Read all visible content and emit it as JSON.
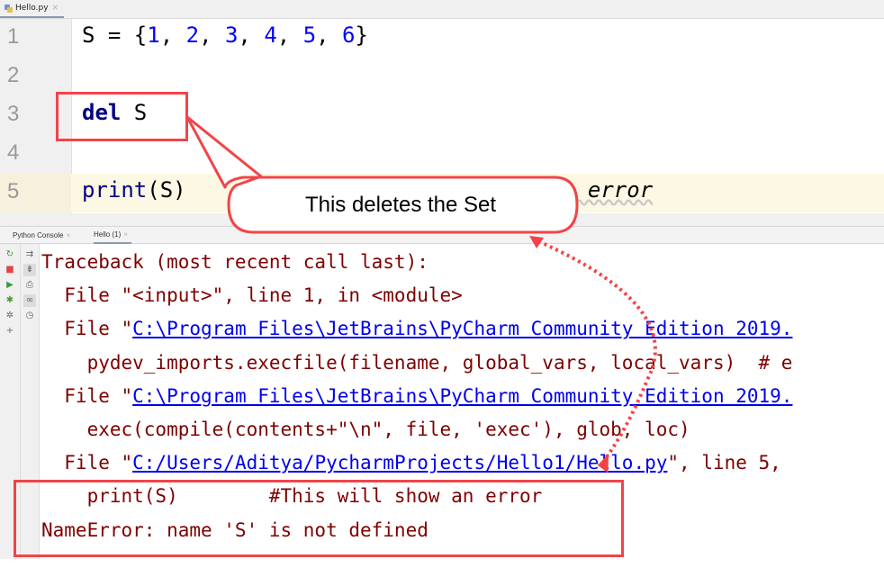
{
  "editor": {
    "tab": {
      "label": "Hello.py",
      "icon": "python-file-icon",
      "close": "×"
    },
    "lines": [
      {
        "num": "1",
        "tokens": [
          {
            "t": "S = {",
            "c": "plain"
          },
          {
            "t": "1",
            "c": "num"
          },
          {
            "t": ", ",
            "c": "plain"
          },
          {
            "t": "2",
            "c": "num"
          },
          {
            "t": ", ",
            "c": "plain"
          },
          {
            "t": "3",
            "c": "num"
          },
          {
            "t": ", ",
            "c": "plain"
          },
          {
            "t": "4",
            "c": "num"
          },
          {
            "t": ", ",
            "c": "plain"
          },
          {
            "t": "5",
            "c": "num"
          },
          {
            "t": ", ",
            "c": "plain"
          },
          {
            "t": "6",
            "c": "num"
          },
          {
            "t": "}",
            "c": "plain"
          }
        ]
      },
      {
        "num": "2",
        "tokens": []
      },
      {
        "num": "3",
        "tokens": [
          {
            "t": "del",
            "c": "kw"
          },
          {
            "t": " S",
            "c": "plain"
          }
        ]
      },
      {
        "num": "4",
        "tokens": []
      },
      {
        "num": "5",
        "tokens": [
          {
            "t": "print",
            "c": "builtin"
          },
          {
            "t": "(S)",
            "c": "plain"
          }
        ],
        "trailing_comment_visible": "n error"
      }
    ]
  },
  "run_window": {
    "tabs": [
      {
        "label": "Python Console",
        "close": "×",
        "active": false
      },
      {
        "label": "Hello (1)",
        "close": "×",
        "active": true
      }
    ],
    "toolbar_left": [
      {
        "icon": "rerun-icon",
        "glyph": "↻",
        "color": "#3c9a3c"
      },
      {
        "icon": "stop-icon",
        "glyph": "■",
        "color": "#e04545"
      },
      {
        "icon": "run-icon",
        "glyph": "▶",
        "color": "#3c9a3c"
      },
      {
        "icon": "debug-icon",
        "glyph": "✱",
        "color": "#4a9a3a"
      },
      {
        "icon": "settings-icon",
        "glyph": "✲",
        "color": "#666666"
      },
      {
        "icon": "add-icon",
        "glyph": "+",
        "color": "#666666"
      }
    ],
    "toolbar_right": [
      {
        "icon": "soft-wrap-icon",
        "glyph": "⇉",
        "color": "#666666",
        "pressed": false
      },
      {
        "icon": "scroll-to-end-icon",
        "glyph": "⇟",
        "color": "#666666",
        "pressed": true
      },
      {
        "icon": "print-icon",
        "glyph": "⎙",
        "color": "#666666",
        "pressed": false
      },
      {
        "icon": "show-variables-icon",
        "glyph": "∞",
        "color": "#666666",
        "pressed": true
      },
      {
        "icon": "history-icon",
        "glyph": "◷",
        "color": "#666666",
        "pressed": false
      }
    ],
    "console_lines": [
      {
        "parts": [
          {
            "t": "Traceback (most recent call last):"
          }
        ]
      },
      {
        "parts": [
          {
            "t": "  File \"<input>\", line 1, in <module>"
          }
        ]
      },
      {
        "parts": [
          {
            "t": "  File \""
          },
          {
            "t": "C:\\Program Files\\JetBrains\\PyCharm Community Edition 2019.",
            "link": true
          }
        ]
      },
      {
        "parts": [
          {
            "t": "    pydev_imports.execfile(filename, global_vars, local_vars)  # e"
          }
        ]
      },
      {
        "parts": [
          {
            "t": "  File \""
          },
          {
            "t": "C:\\Program Files\\JetBrains\\PyCharm Community Edition 2019.",
            "link": true
          }
        ]
      },
      {
        "parts": [
          {
            "t": "    exec(compile(contents+\"\\n\", file, 'exec'), glob, loc)"
          }
        ]
      },
      {
        "parts": [
          {
            "t": "  File \""
          },
          {
            "t": "C:/Users/Aditya/PycharmProjects/Hello1/Hello.py",
            "link": true
          },
          {
            "t": "\", line 5,"
          }
        ]
      },
      {
        "parts": [
          {
            "t": "    print(S)        #This will show an error"
          }
        ]
      },
      {
        "parts": [
          {
            "t": "NameError: name 'S' is not defined"
          }
        ]
      }
    ]
  },
  "annotations": {
    "callout_text": "This deletes the Set",
    "accent_color": "#f24448"
  }
}
